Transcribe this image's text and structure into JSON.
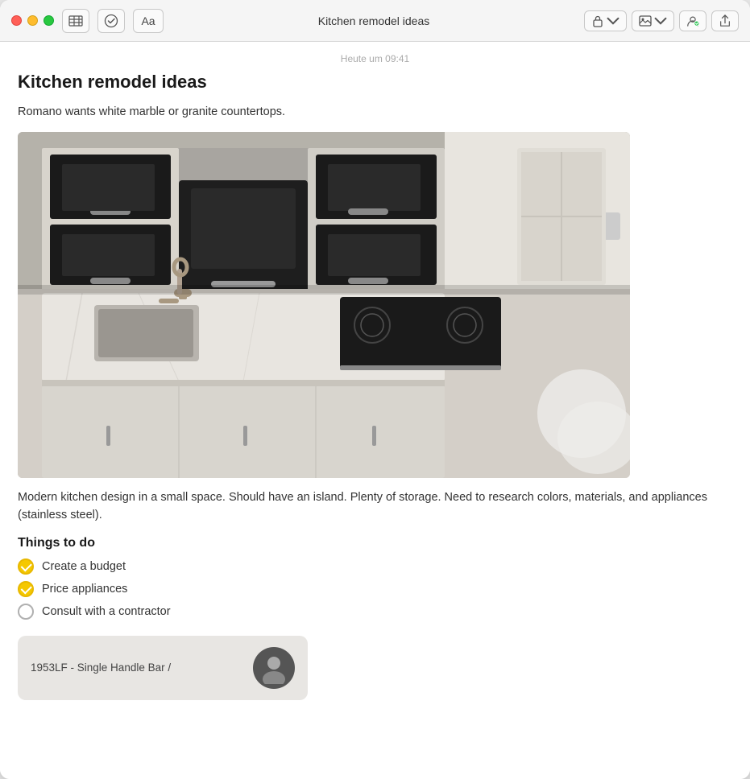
{
  "window": {
    "title": "Kitchen remodel ideas"
  },
  "toolbar": {
    "table_icon": "⊞",
    "checkmark_icon": "✓",
    "text_btn_label": "Aa"
  },
  "titlebar_right": {
    "lock_label": "🔒",
    "gallery_label": "🖼",
    "collab_label": "👤",
    "share_label": "↑"
  },
  "note": {
    "timestamp": "Heute um 09:41",
    "title": "Kitchen remodel ideas",
    "paragraph1": "Romano wants white marble or granite countertops.",
    "paragraph2": "Modern kitchen design in a small space. Should have an island. Plenty of storage. Need to research colors, materials, and appliances (stainless steel).",
    "section_heading": "Things to do",
    "checklist": [
      {
        "text": "Create a budget",
        "checked": true
      },
      {
        "text": "Price appliances",
        "checked": true
      },
      {
        "text": "Consult with a contractor",
        "checked": false
      }
    ],
    "bottom_card_text": "1953LF - Single Handle Bar /"
  }
}
